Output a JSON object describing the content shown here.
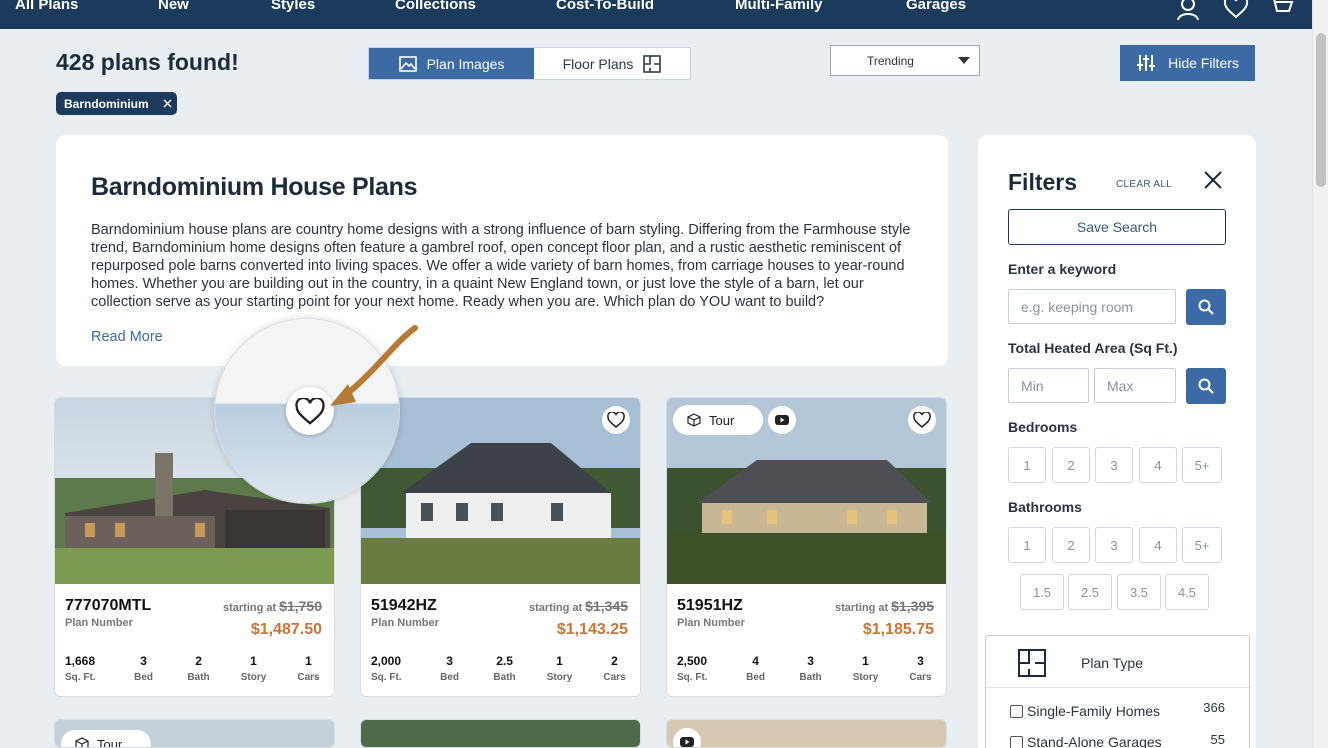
{
  "nav": {
    "items": [
      "All Plans",
      "New",
      "Styles",
      "Collections",
      "Cost-To-Build",
      "Multi-Family",
      "Garages"
    ]
  },
  "results": {
    "count_text": "428 plans found!",
    "view_toggle": {
      "active": "Plan Images",
      "inactive": "Floor Plans"
    },
    "sort": {
      "selected": "Trending"
    },
    "hide_filters_label": "Hide Filters",
    "active_tag": "Barndominium"
  },
  "intro": {
    "title": "Barndominium House Plans",
    "body": "Barndominium house plans are country home designs with a strong influence of barn styling. Differing from the Farmhouse style trend, Barndominium home designs often feature a gambrel roof, open concept floor plan, and a rustic aesthetic reminiscent of repurposed pole barns converted into living spaces. We offer a wide variety of barn homes, from carriage houses to year-round homes. Whether you are building out in the country, in a quaint New England town, or just love the style of a barn, let our collection serve as your starting point for your next home. Ready when you are. Which plan do YOU want to build?",
    "read_more": "Read More"
  },
  "plans": [
    {
      "number": "777070MTL",
      "number_label": "Plan Number",
      "starting_label": "starting at",
      "old_price": "$1,750",
      "price": "$1,487.50",
      "specs": [
        {
          "value": "1,668",
          "label": "Sq. Ft."
        },
        {
          "value": "3",
          "label": "Bed"
        },
        {
          "value": "2",
          "label": "Bath"
        },
        {
          "value": "1",
          "label": "Story"
        },
        {
          "value": "1",
          "label": "Cars"
        }
      ]
    },
    {
      "number": "51942HZ",
      "number_label": "Plan Number",
      "starting_label": "starting at",
      "old_price": "$1,345",
      "price": "$1,143.25",
      "specs": [
        {
          "value": "2,000",
          "label": "Sq. Ft."
        },
        {
          "value": "3",
          "label": "Bed"
        },
        {
          "value": "2.5",
          "label": "Bath"
        },
        {
          "value": "1",
          "label": "Story"
        },
        {
          "value": "2",
          "label": "Cars"
        }
      ]
    },
    {
      "number": "51951HZ",
      "number_label": "Plan Number",
      "starting_label": "starting at",
      "old_price": "$1,395",
      "price": "$1,185.75",
      "tour_label": "Tour",
      "specs": [
        {
          "value": "2,500",
          "label": "Sq. Ft."
        },
        {
          "value": "4",
          "label": "Bed"
        },
        {
          "value": "3",
          "label": "Bath"
        },
        {
          "value": "1",
          "label": "Story"
        },
        {
          "value": "3",
          "label": "Cars"
        }
      ]
    }
  ],
  "row2": {
    "tour_label": "Tour"
  },
  "filters": {
    "title": "Filters",
    "clear_all": "CLEAR ALL",
    "save_search": "Save Search",
    "keyword_label": "Enter a keyword",
    "keyword_placeholder": "e.g. keeping room",
    "area_label": "Total Heated Area (Sq Ft.)",
    "min_placeholder": "Min",
    "max_placeholder": "Max",
    "bedrooms_label": "Bedrooms",
    "bedrooms": [
      "1",
      "2",
      "3",
      "4",
      "5+"
    ],
    "bathrooms_label": "Bathrooms",
    "bathrooms": [
      "1",
      "2",
      "3",
      "4",
      "5+"
    ],
    "half_baths": [
      "1.5",
      "2.5",
      "3.5",
      "4.5"
    ],
    "plan_type": {
      "title": "Plan Type",
      "options": [
        {
          "label": "Single-Family Homes",
          "count": "366"
        },
        {
          "label": "Stand-Alone Garages",
          "count": "55"
        }
      ]
    }
  },
  "colors": {
    "navy": "#1b3a5c",
    "accent_blue": "#3c6aa5",
    "price_orange": "#c8753a"
  }
}
